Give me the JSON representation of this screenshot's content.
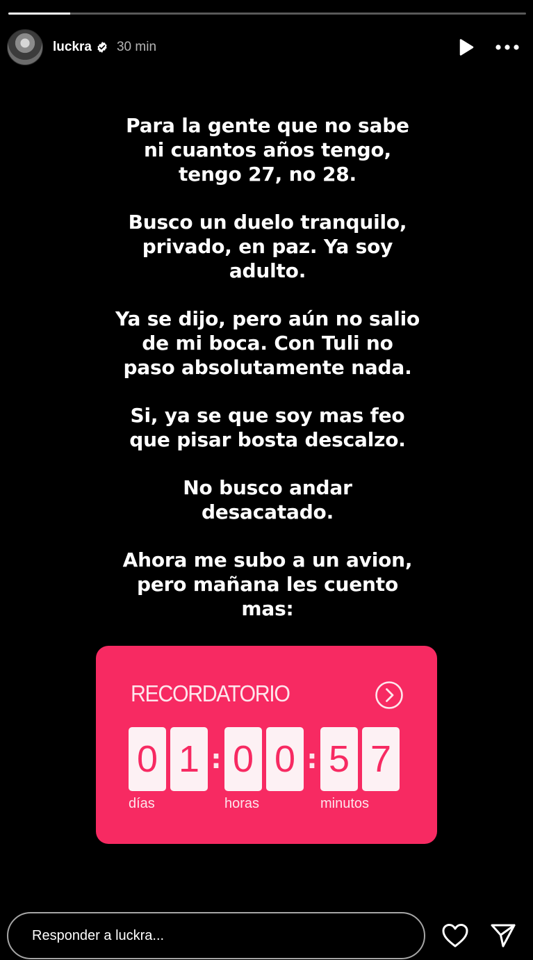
{
  "story": {
    "progress": 0.12
  },
  "header": {
    "username": "luckra",
    "time": "30 min",
    "icons": [
      "avatar",
      "verified-badge-icon",
      "play-icon",
      "more-options-icon"
    ]
  },
  "content": {
    "paragraphs": [
      "Para la gente que no sabe\nni cuantos años tengo,\ntengo 27, no 28.",
      "Busco un duelo tranquilo,\nprivado, en paz. Ya soy\nadulto.",
      "Ya se dijo, pero aún no salio\nde mi boca. Con Tuli no\npaso absolutamente nada.",
      "Si, ya se que soy mas feo\nque pisar bosta descalzo.",
      "No busco andar\ndesacatado.",
      "Ahora me subo a un avion,\npero mañana les cuento\nmas:"
    ]
  },
  "reminder": {
    "title": "RECORDATORIO",
    "digits": [
      "0",
      "1",
      "0",
      "0",
      "5",
      "7"
    ],
    "labels": {
      "days": "días",
      "hours": "horas",
      "minutes": "minutos"
    },
    "colors": {
      "background": "#f72a62",
      "digit_bg": "#fdf1f4"
    }
  },
  "footer": {
    "reply_placeholder": "Responder a luckra...",
    "icons": [
      "heart-icon",
      "send-icon"
    ]
  }
}
